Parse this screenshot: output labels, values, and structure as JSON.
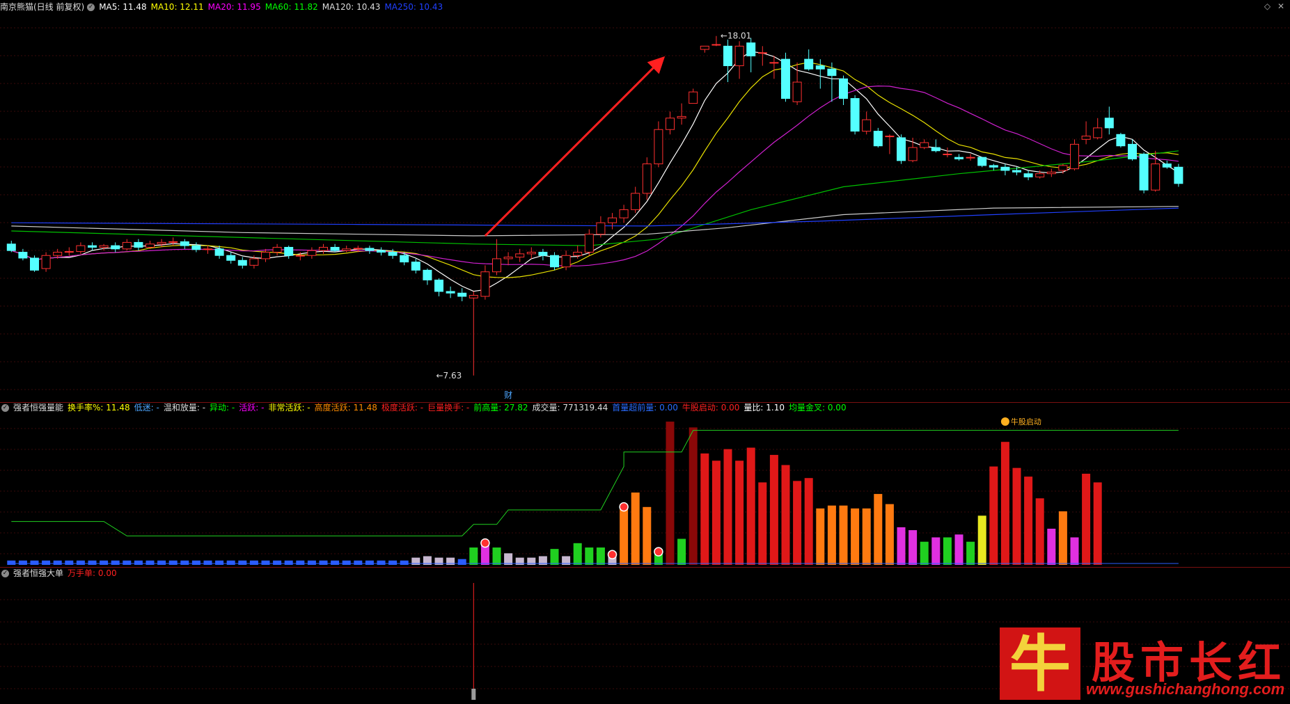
{
  "main": {
    "title": "南京熊猫(日线 前复权)",
    "indicators": [
      {
        "label": "MA5: 11.48",
        "color": "#ffffff"
      },
      {
        "label": "MA10: 12.11",
        "color": "#ffff00"
      },
      {
        "label": "MA20: 11.95",
        "color": "#ff00ff"
      },
      {
        "label": "MA60: 11.82",
        "color": "#00ff00"
      },
      {
        "label": "MA120: 10.43",
        "color": "#dddddd"
      },
      {
        "label": "MA250: 10.43",
        "color": "#2040ff"
      }
    ],
    "high_label": "18.01",
    "low_label": "7.63",
    "finance_marker": "财",
    "window_icons": [
      "◇",
      "✕"
    ]
  },
  "volume_panel": {
    "name": "强者恒强量能",
    "items": [
      {
        "label": "换手率%: 11.48",
        "color": "#ffff00"
      },
      {
        "label": "低迷: -",
        "color": "#4da6ff"
      },
      {
        "label": "温和放量: -",
        "color": "#dddddd"
      },
      {
        "label": "异动: -",
        "color": "#00ff00"
      },
      {
        "label": "活跃: -",
        "color": "#ff00ff"
      },
      {
        "label": "非常活跃: -",
        "color": "#ffff00"
      },
      {
        "label": "高度活跃: 11.48",
        "color": "#ff8c00"
      },
      {
        "label": "极度活跃: -",
        "color": "#ff2020"
      },
      {
        "label": "巨量换手: -",
        "color": "#ff2020"
      },
      {
        "label": "前高量: 27.82",
        "color": "#00ff00"
      },
      {
        "label": "成交量: 771319.44",
        "color": "#dddddd"
      },
      {
        "label": "首量超前量: 0.00",
        "color": "#2a6cff"
      },
      {
        "label": "牛股启动: 0.00",
        "color": "#ff2020"
      },
      {
        "label": "量比: 1.10",
        "color": "#ffffff"
      },
      {
        "label": "均量金叉: 0.00",
        "color": "#00ff00"
      }
    ],
    "callout": "牛股启动"
  },
  "bigorder_panel": {
    "name": "强者恒强大单",
    "items": [
      {
        "label": "万手单: 0.00",
        "color": "#ff2020"
      }
    ]
  },
  "watermark": {
    "logo_char": "牛",
    "title": "股市长红",
    "url": "www.gushichanghong.com"
  },
  "chart_data": {
    "type": "candlestick",
    "price_range": [
      7.2,
      18.6
    ],
    "candles": [
      [
        11.65,
        11.45,
        11.75,
        11.4
      ],
      [
        11.4,
        11.22,
        11.5,
        11.15
      ],
      [
        11.22,
        10.85,
        11.3,
        10.8
      ],
      [
        10.9,
        11.3,
        11.4,
        10.8
      ],
      [
        11.3,
        11.4,
        11.5,
        11.2
      ],
      [
        11.4,
        11.42,
        11.55,
        11.3
      ],
      [
        11.42,
        11.6,
        11.7,
        11.35
      ],
      [
        11.6,
        11.55,
        11.7,
        11.45
      ],
      [
        11.55,
        11.6,
        11.65,
        11.45
      ],
      [
        11.6,
        11.5,
        11.7,
        11.4
      ],
      [
        11.5,
        11.7,
        11.8,
        11.45
      ],
      [
        11.7,
        11.55,
        11.8,
        11.45
      ],
      [
        11.55,
        11.65,
        11.75,
        11.5
      ],
      [
        11.65,
        11.7,
        11.8,
        11.55
      ],
      [
        11.7,
        11.72,
        11.85,
        11.6
      ],
      [
        11.72,
        11.6,
        11.8,
        11.5
      ],
      [
        11.6,
        11.48,
        11.7,
        11.4
      ],
      [
        11.48,
        11.5,
        11.6,
        11.35
      ],
      [
        11.5,
        11.3,
        11.6,
        11.2
      ],
      [
        11.3,
        11.15,
        11.4,
        11.05
      ],
      [
        11.15,
        11.0,
        11.25,
        10.9
      ],
      [
        11.0,
        11.2,
        11.3,
        10.9
      ],
      [
        11.2,
        11.4,
        11.5,
        11.1
      ],
      [
        11.4,
        11.55,
        11.65,
        11.3
      ],
      [
        11.55,
        11.3,
        11.6,
        11.2
      ],
      [
        11.3,
        11.3,
        11.4,
        11.15
      ],
      [
        11.3,
        11.45,
        11.55,
        11.2
      ],
      [
        11.45,
        11.55,
        11.65,
        11.35
      ],
      [
        11.55,
        11.45,
        11.65,
        11.4
      ],
      [
        11.45,
        11.5,
        11.6,
        11.4
      ],
      [
        11.5,
        11.52,
        11.6,
        11.4
      ],
      [
        11.52,
        11.45,
        11.6,
        11.35
      ],
      [
        11.45,
        11.4,
        11.55,
        11.3
      ],
      [
        11.4,
        11.3,
        11.5,
        11.2
      ],
      [
        11.3,
        11.1,
        11.4,
        11.0
      ],
      [
        11.1,
        10.85,
        11.2,
        10.75
      ],
      [
        10.85,
        10.55,
        10.9,
        10.4
      ],
      [
        10.55,
        10.2,
        10.6,
        10.05
      ],
      [
        10.2,
        10.15,
        10.35,
        10.0
      ],
      [
        10.15,
        10.05,
        10.3,
        9.9
      ],
      [
        10.0,
        10.08,
        10.2,
        7.63
      ],
      [
        10.05,
        10.8,
        11.0,
        9.95
      ],
      [
        10.8,
        11.2,
        11.8,
        10.7
      ],
      [
        11.2,
        11.25,
        11.4,
        11.0
      ],
      [
        11.25,
        11.35,
        11.5,
        11.1
      ],
      [
        11.35,
        11.4,
        11.55,
        11.2
      ],
      [
        11.4,
        11.3,
        11.5,
        11.15
      ],
      [
        11.3,
        10.95,
        11.4,
        10.85
      ],
      [
        10.95,
        11.3,
        11.45,
        10.85
      ],
      [
        11.3,
        11.4,
        11.6,
        11.2
      ],
      [
        11.4,
        11.95,
        12.1,
        11.3
      ],
      [
        11.95,
        12.3,
        12.5,
        11.85
      ],
      [
        12.3,
        12.45,
        12.6,
        12.1
      ],
      [
        12.45,
        12.7,
        12.85,
        12.3
      ],
      [
        12.7,
        13.2,
        13.4,
        12.6
      ],
      [
        13.2,
        14.1,
        14.3,
        13.0
      ],
      [
        14.1,
        15.15,
        15.4,
        14.0
      ],
      [
        15.15,
        15.5,
        15.7,
        15.0
      ],
      [
        15.5,
        15.55,
        15.95,
        15.3
      ],
      [
        15.95,
        16.3,
        16.4,
        16.0
      ],
      [
        17.6,
        17.7,
        17.7,
        17.5
      ],
      [
        17.75,
        17.75,
        18.01,
        17.7
      ],
      [
        17.7,
        17.1,
        17.9,
        16.6
      ],
      [
        17.1,
        17.7,
        17.85,
        16.7
      ],
      [
        17.8,
        17.4,
        17.95,
        16.9
      ],
      [
        17.5,
        17.5,
        17.7,
        17.1
      ],
      [
        17.2,
        17.2,
        17.4,
        16.7
      ],
      [
        17.3,
        16.1,
        17.5,
        16.0
      ],
      [
        16.0,
        16.6,
        17.2,
        15.9
      ],
      [
        17.3,
        17.0,
        17.6,
        16.95
      ],
      [
        17.1,
        17.0,
        17.3,
        16.4
      ],
      [
        17.0,
        16.8,
        17.2,
        16.0
      ],
      [
        16.7,
        16.1,
        16.8,
        15.9
      ],
      [
        16.1,
        15.1,
        16.2,
        15.0
      ],
      [
        15.1,
        15.45,
        15.7,
        15.0
      ],
      [
        15.1,
        14.65,
        15.2,
        14.6
      ],
      [
        14.95,
        14.95,
        15.0,
        14.4
      ],
      [
        14.9,
        14.2,
        15.0,
        14.1
      ],
      [
        14.2,
        14.6,
        14.9,
        14.15
      ],
      [
        14.6,
        14.75,
        14.85,
        14.55
      ],
      [
        14.6,
        14.5,
        14.85,
        14.45
      ],
      [
        14.4,
        14.4,
        14.6,
        14.3
      ],
      [
        14.3,
        14.25,
        14.4,
        14.2
      ],
      [
        14.3,
        14.3,
        14.4,
        14.2
      ],
      [
        14.3,
        14.05,
        14.3,
        14.0
      ],
      [
        14.05,
        14.0,
        14.1,
        13.9
      ],
      [
        14.0,
        13.9,
        14.1,
        13.75
      ],
      [
        13.9,
        13.85,
        14.0,
        13.75
      ],
      [
        13.8,
        13.7,
        13.9,
        13.6
      ],
      [
        13.7,
        13.8,
        13.9,
        13.65
      ],
      [
        13.8,
        13.85,
        13.95,
        13.7
      ],
      [
        13.9,
        14.05,
        14.1,
        13.8
      ],
      [
        13.95,
        14.7,
        14.85,
        13.9
      ],
      [
        14.85,
        14.95,
        15.4,
        14.7
      ],
      [
        14.9,
        15.2,
        15.5,
        14.85
      ],
      [
        15.5,
        15.2,
        15.85,
        15.0
      ],
      [
        15.0,
        14.65,
        15.05,
        14.6
      ],
      [
        14.7,
        14.25,
        14.85,
        14.2
      ],
      [
        14.4,
        13.3,
        14.45,
        13.2
      ],
      [
        13.3,
        14.1,
        14.5,
        13.25
      ],
      [
        14.1,
        14.0,
        14.2,
        13.95
      ],
      [
        14.0,
        13.5,
        14.1,
        13.4
      ]
    ],
    "volumes": [
      {
        "v": 3,
        "c": "blue"
      },
      {
        "v": 3,
        "c": "blue"
      },
      {
        "v": 3,
        "c": "blue"
      },
      {
        "v": 3,
        "c": "blue"
      },
      {
        "v": 3,
        "c": "blue"
      },
      {
        "v": 3,
        "c": "blue"
      },
      {
        "v": 3,
        "c": "blue"
      },
      {
        "v": 3,
        "c": "blue"
      },
      {
        "v": 3,
        "c": "blue"
      },
      {
        "v": 3,
        "c": "blue"
      },
      {
        "v": 3,
        "c": "blue"
      },
      {
        "v": 3,
        "c": "blue"
      },
      {
        "v": 3,
        "c": "blue"
      },
      {
        "v": 3,
        "c": "blue"
      },
      {
        "v": 3,
        "c": "blue"
      },
      {
        "v": 3,
        "c": "blue"
      },
      {
        "v": 3,
        "c": "blue"
      },
      {
        "v": 3,
        "c": "blue"
      },
      {
        "v": 3,
        "c": "blue"
      },
      {
        "v": 3,
        "c": "blue"
      },
      {
        "v": 3,
        "c": "blue"
      },
      {
        "v": 3,
        "c": "blue"
      },
      {
        "v": 3,
        "c": "blue"
      },
      {
        "v": 3,
        "c": "blue"
      },
      {
        "v": 3,
        "c": "blue"
      },
      {
        "v": 3,
        "c": "blue"
      },
      {
        "v": 3,
        "c": "blue"
      },
      {
        "v": 3,
        "c": "blue"
      },
      {
        "v": 3,
        "c": "blue"
      },
      {
        "v": 3,
        "c": "blue"
      },
      {
        "v": 3,
        "c": "blue"
      },
      {
        "v": 3,
        "c": "blue"
      },
      {
        "v": 3,
        "c": "blue"
      },
      {
        "v": 3,
        "c": "blue"
      },
      {
        "v": 3,
        "c": "blue"
      },
      {
        "v": 5,
        "c": "gray"
      },
      {
        "v": 6,
        "c": "gray"
      },
      {
        "v": 5,
        "c": "gray"
      },
      {
        "v": 5,
        "c": "gray"
      },
      {
        "v": 4,
        "c": "blue"
      },
      {
        "v": 12,
        "c": "green"
      },
      {
        "v": 17,
        "c": "magenta"
      },
      {
        "v": 12,
        "c": "green"
      },
      {
        "v": 8,
        "c": "gray"
      },
      {
        "v": 5,
        "c": "gray"
      },
      {
        "v": 5,
        "c": "gray"
      },
      {
        "v": 6,
        "c": "gray"
      },
      {
        "v": 11,
        "c": "green"
      },
      {
        "v": 6,
        "c": "gray"
      },
      {
        "v": 15,
        "c": "green"
      },
      {
        "v": 12,
        "c": "green"
      },
      {
        "v": 12,
        "c": "green"
      },
      {
        "v": 9,
        "c": "gray"
      },
      {
        "v": 42,
        "c": "orange"
      },
      {
        "v": 50,
        "c": "orange"
      },
      {
        "v": 40,
        "c": "orange"
      },
      {
        "v": 11,
        "c": "green"
      },
      {
        "v": 99,
        "c": "darkred"
      },
      {
        "v": 18,
        "c": "green"
      },
      {
        "v": 95,
        "c": "darkred"
      },
      {
        "v": 77,
        "c": "red"
      },
      {
        "v": 72,
        "c": "red"
      },
      {
        "v": 80,
        "c": "red"
      },
      {
        "v": 72,
        "c": "red"
      },
      {
        "v": 81,
        "c": "red"
      },
      {
        "v": 57,
        "c": "red"
      },
      {
        "v": 76,
        "c": "red"
      },
      {
        "v": 69,
        "c": "red"
      },
      {
        "v": 58,
        "c": "red"
      },
      {
        "v": 60,
        "c": "red"
      },
      {
        "v": 39,
        "c": "orange"
      },
      {
        "v": 41,
        "c": "orange"
      },
      {
        "v": 41,
        "c": "orange"
      },
      {
        "v": 39,
        "c": "orange"
      },
      {
        "v": 39,
        "c": "orange"
      },
      {
        "v": 49,
        "c": "orange"
      },
      {
        "v": 42,
        "c": "orange"
      },
      {
        "v": 26,
        "c": "magenta"
      },
      {
        "v": 24,
        "c": "magenta"
      },
      {
        "v": 16,
        "c": "green"
      },
      {
        "v": 19,
        "c": "magenta"
      },
      {
        "v": 19,
        "c": "green"
      },
      {
        "v": 21,
        "c": "magenta"
      },
      {
        "v": 16,
        "c": "green"
      },
      {
        "v": 34,
        "c": "yellow"
      },
      {
        "v": 68,
        "c": "red"
      },
      {
        "v": 85,
        "c": "red"
      },
      {
        "v": 67,
        "c": "red"
      },
      {
        "v": 61,
        "c": "red"
      },
      {
        "v": 46,
        "c": "red"
      },
      {
        "v": 25,
        "c": "magenta"
      },
      {
        "v": 37,
        "c": "orange"
      },
      {
        "v": 19,
        "c": "magenta"
      },
      {
        "v": 63,
        "c": "red"
      },
      {
        "v": 57,
        "c": "red"
      }
    ],
    "volume_max": 100
  }
}
